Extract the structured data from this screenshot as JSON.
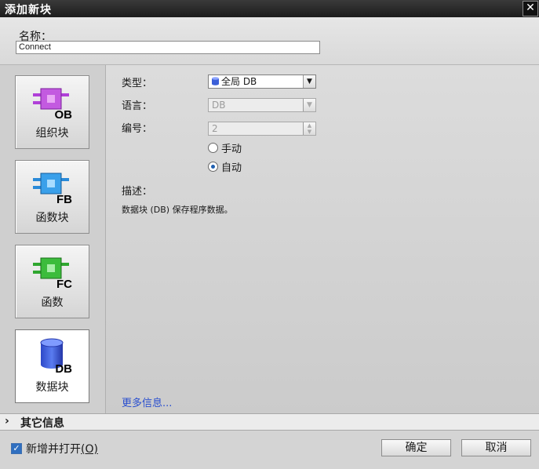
{
  "window": {
    "title": "添加新块",
    "close_glyph": "✕"
  },
  "name": {
    "label": "名称：",
    "value": "Connect"
  },
  "blocks": [
    {
      "code": "OB",
      "label": "组织块",
      "icon": "ob-block-icon",
      "color": "#b040d8"
    },
    {
      "code": "FB",
      "label": "函数块",
      "icon": "fb-block-icon",
      "color": "#2a8ad8"
    },
    {
      "code": "FC",
      "label": "函数",
      "icon": "fc-block-icon",
      "color": "#2fa62f"
    },
    {
      "code": "DB",
      "label": "数据块",
      "icon": "db-block-icon",
      "color": "#3b5fd8"
    }
  ],
  "form": {
    "type": {
      "label": "类型：",
      "value": "全局 DB"
    },
    "language": {
      "label": "语言：",
      "value": "DB"
    },
    "number": {
      "label": "编号：",
      "value": "2"
    },
    "radio_manual": "手动",
    "radio_auto": "自动",
    "description_label": "描述：",
    "description_text": "数据块 (DB) 保存程序数据。",
    "more_info": "更多信息..."
  },
  "other_info": {
    "label": "其它信息",
    "chevron": "›"
  },
  "footer": {
    "checkbox_checked": true,
    "add_open_label": "新增并打开",
    "add_open_hotkey": "(O)",
    "ok_label": "确定",
    "cancel_label": "取消"
  }
}
